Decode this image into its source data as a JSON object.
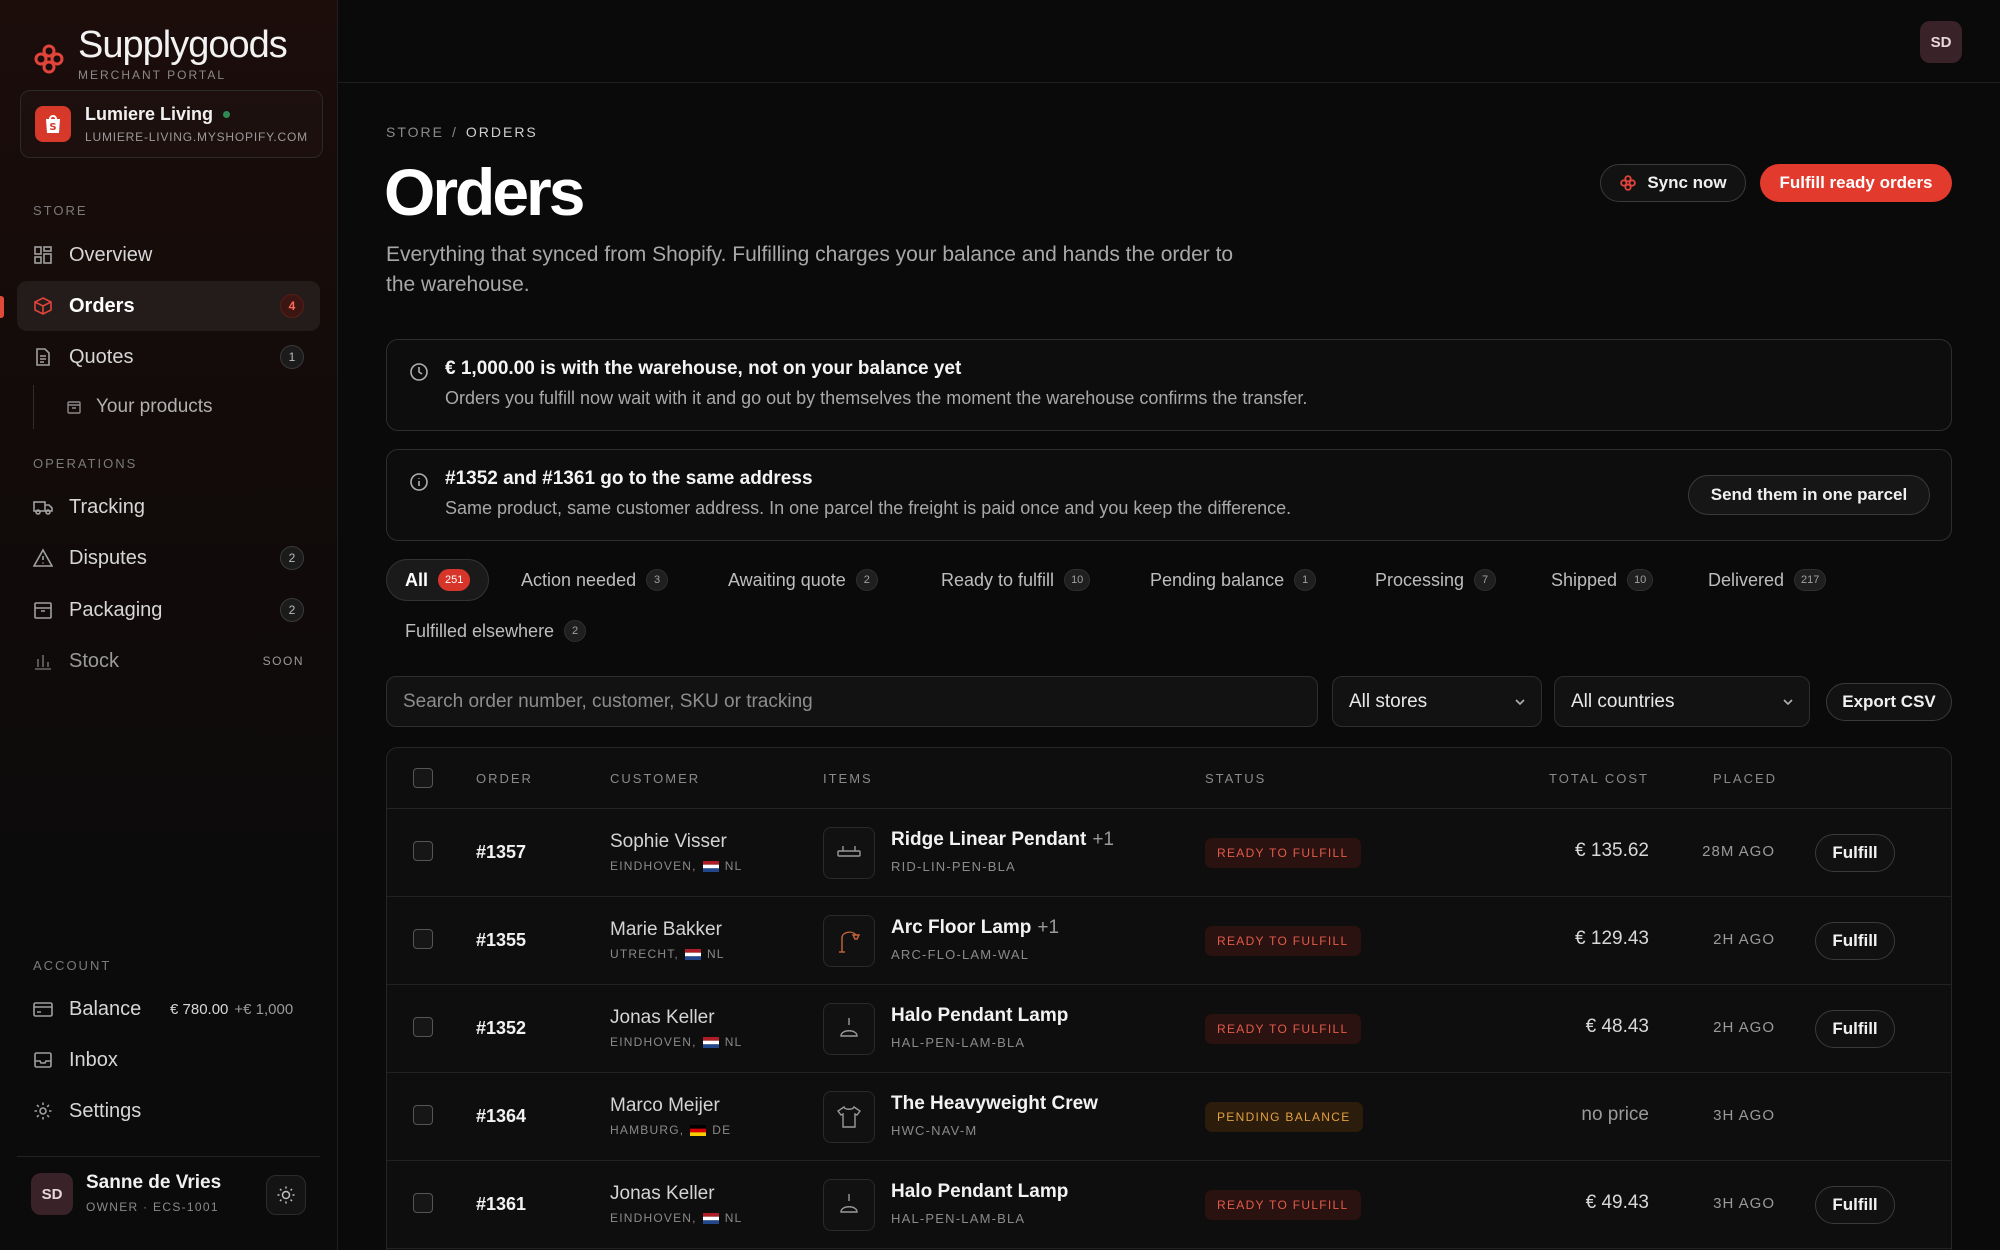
{
  "brand": {
    "name": "Supplygoods",
    "subtitle": "MERCHANT PORTAL"
  },
  "store": {
    "name": "Lumiere Living",
    "domain": "LUMIERE-LIVING.MYSHOPIFY.COM"
  },
  "sidebar": {
    "store_label": "STORE",
    "operations_label": "OPERATIONS",
    "account_label": "ACCOUNT",
    "overview": "Overview",
    "orders": {
      "label": "Orders",
      "badge": "4"
    },
    "quotes": {
      "label": "Quotes",
      "badge": "1"
    },
    "your_products": "Your products",
    "tracking": "Tracking",
    "disputes": {
      "label": "Disputes",
      "badge": "2"
    },
    "packaging": {
      "label": "Packaging",
      "badge": "2"
    },
    "stock": {
      "label": "Stock",
      "tag": "SOON"
    },
    "balance": {
      "label": "Balance",
      "amount": "€ 780.00",
      "pending": "+€ 1,000"
    },
    "inbox": "Inbox",
    "settings": "Settings"
  },
  "user": {
    "initials": "SD",
    "name": "Sanne de Vries",
    "role": "OWNER · ECS-1001"
  },
  "breadcrumb": {
    "store": "STORE",
    "separator": "/",
    "current": "ORDERS"
  },
  "page": {
    "title": "Orders",
    "description": "Everything that synced from Shopify. Fulfilling charges your balance and hands the order to the warehouse.",
    "sync_label": "Sync now",
    "fulfill_ready_label": "Fulfill ready orders"
  },
  "notices": {
    "warehouse": {
      "title": "€ 1,000.00 is with the warehouse, not on your balance yet",
      "body": "Orders you fulfill now wait with it and go out by themselves the moment the warehouse confirms the transfer."
    },
    "same_address": {
      "title": "#1352 and #1361 go to the same address",
      "body": "Same product, same customer address. In one parcel the freight is paid once and you keep the difference.",
      "action": "Send them in one parcel"
    }
  },
  "tabs": [
    {
      "label": "All",
      "count": "251"
    },
    {
      "label": "Action needed",
      "count": "3"
    },
    {
      "label": "Awaiting quote",
      "count": "2"
    },
    {
      "label": "Ready to fulfill",
      "count": "10"
    },
    {
      "label": "Pending balance",
      "count": "1"
    },
    {
      "label": "Processing",
      "count": "7"
    },
    {
      "label": "Shipped",
      "count": "10"
    },
    {
      "label": "Delivered",
      "count": "217"
    },
    {
      "label": "Fulfilled elsewhere",
      "count": "2"
    }
  ],
  "filters": {
    "search_placeholder": "Search order number, customer, SKU or tracking",
    "stores": "All stores",
    "countries": "All countries",
    "export": "Export CSV"
  },
  "table": {
    "headers": {
      "order": "ORDER",
      "customer": "CUSTOMER",
      "items": "ITEMS",
      "status": "STATUS",
      "total": "TOTAL COST",
      "placed": "PLACED"
    },
    "rows": [
      {
        "order": "#1357",
        "customer": "Sophie Visser",
        "city": "EINDHOVEN,",
        "country": "NL",
        "product": "Ridge Linear Pendant",
        "extra": "+1",
        "sku": "RID-LIN-PEN-BLA",
        "status": "READY TO FULFILL",
        "cost": "€ 135.62",
        "placed": "28M AGO",
        "action": "Fulfill"
      },
      {
        "order": "#1355",
        "customer": "Marie Bakker",
        "city": "UTRECHT,",
        "country": "NL",
        "product": "Arc Floor Lamp",
        "extra": "+1",
        "sku": "ARC-FLO-LAM-WAL",
        "status": "READY TO FULFILL",
        "cost": "€ 129.43",
        "placed": "2H AGO",
        "action": "Fulfill"
      },
      {
        "order": "#1352",
        "customer": "Jonas Keller",
        "city": "EINDHOVEN,",
        "country": "NL",
        "product": "Halo Pendant Lamp",
        "extra": "",
        "sku": "HAL-PEN-LAM-BLA",
        "status": "READY TO FULFILL",
        "cost": "€ 48.43",
        "placed": "2H AGO",
        "action": "Fulfill"
      },
      {
        "order": "#1364",
        "customer": "Marco Meijer",
        "city": "HAMBURG,",
        "country": "DE",
        "product": "The Heavyweight Crew",
        "extra": "",
        "sku": "HWC-NAV-M",
        "status": "PENDING BALANCE",
        "cost": "no price",
        "placed": "3H AGO",
        "action": ""
      },
      {
        "order": "#1361",
        "customer": "Jonas Keller",
        "city": "EINDHOVEN,",
        "country": "NL",
        "product": "Halo Pendant Lamp",
        "extra": "",
        "sku": "HAL-PEN-LAM-BLA",
        "status": "READY TO FULFILL",
        "cost": "€ 49.43",
        "placed": "3H AGO",
        "action": "Fulfill"
      }
    ]
  },
  "colors": {
    "accent": "#e23a2c",
    "ready": "#e35a4a",
    "pending": "#e3a140",
    "online": "#2e8a53"
  }
}
